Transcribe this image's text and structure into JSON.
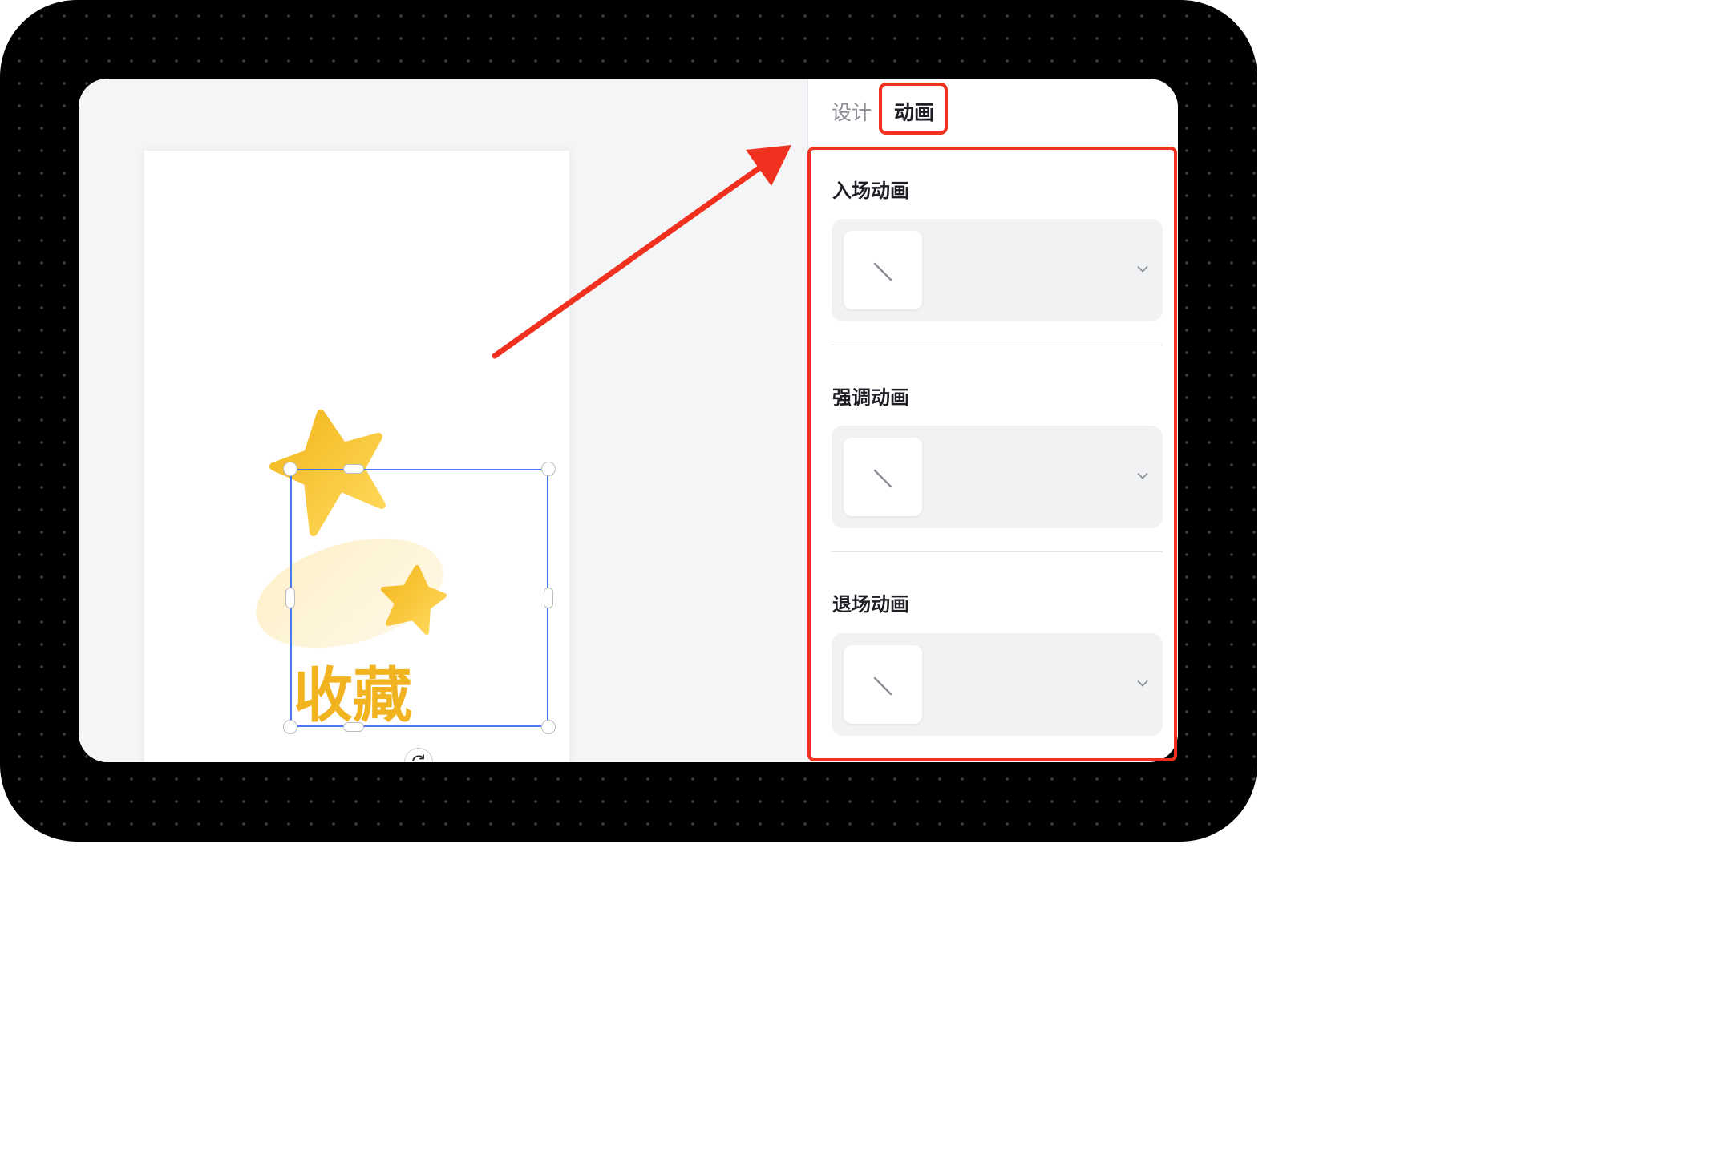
{
  "tabs": {
    "design_label": "设计",
    "animation_label": "动画"
  },
  "sections": {
    "entrance_title": "入场动画",
    "emphasis_title": "强调动画",
    "exit_title": "退场动画"
  },
  "canvas": {
    "element_text": "收藏"
  },
  "colors": {
    "selection": "#4b78f2",
    "annotation": "#f0311f",
    "element_text": "#f2b320"
  },
  "icons": {
    "thumb": "none-slash-icon",
    "dropdown": "chevron-down-icon",
    "rotate": "rotate-icon"
  }
}
